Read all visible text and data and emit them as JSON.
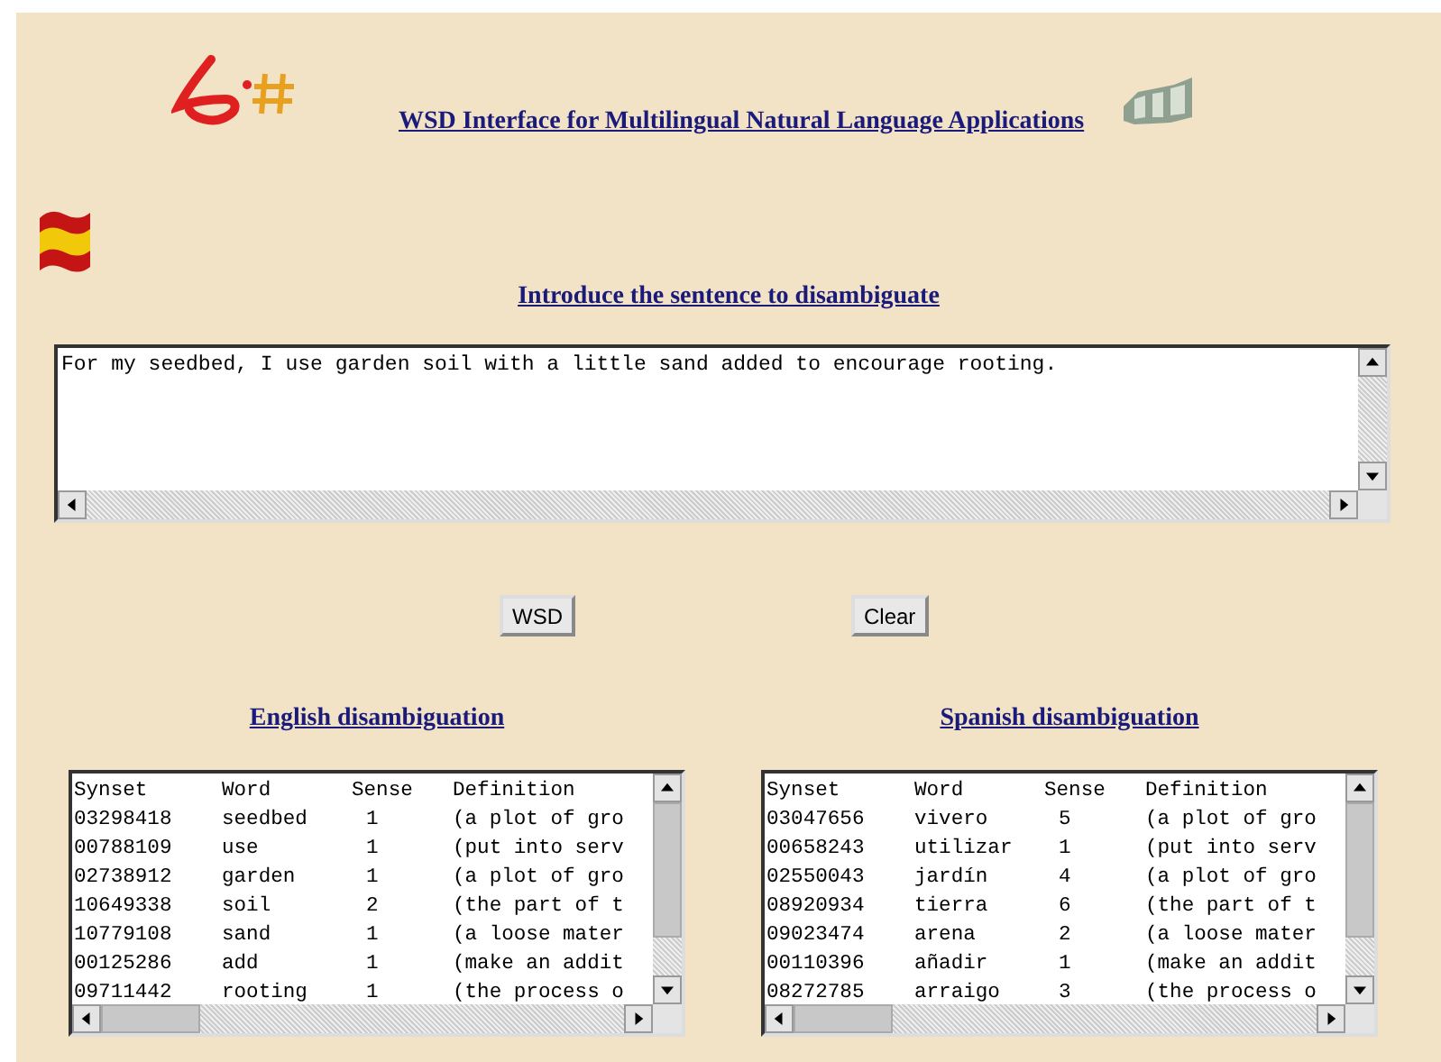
{
  "header": {
    "title": "WSD Interface for Multilingual Natural Language Applications"
  },
  "prompt": "Introduce the sentence to disambiguate",
  "sentence": "For my seedbed, I use garden soil with a little sand added to encourage rooting.",
  "buttons": [
    "WSD",
    "Clear"
  ],
  "results": [
    {
      "heading": "English disambiguation",
      "columns": [
        "Synset",
        "Word",
        "Sense",
        "Definition"
      ],
      "rows": [
        [
          "03298418",
          "seedbed",
          "1",
          "(a plot of gro"
        ],
        [
          "00788109",
          "use",
          "1",
          "(put into serv"
        ],
        [
          "02738912",
          "garden",
          "1",
          "(a plot of gro"
        ],
        [
          "10649338",
          "soil",
          "2",
          "(the part of t"
        ],
        [
          "10779108",
          "sand",
          "1",
          "(a loose mater"
        ],
        [
          "00125286",
          "add",
          "1",
          "(make an addit"
        ],
        [
          "09711442",
          "rooting",
          "1",
          "(the process o"
        ]
      ]
    },
    {
      "heading": "Spanish disambiguation",
      "columns": [
        "Synset",
        "Word",
        "Sense",
        "Definition"
      ],
      "rows": [
        [
          "03047656",
          "vivero",
          "5",
          "(a plot of gro"
        ],
        [
          "00658243",
          "utilizar",
          "1",
          "(put into serv"
        ],
        [
          "02550043",
          "jardín",
          "4",
          "(a plot of gro"
        ],
        [
          "08920934",
          "tierra",
          "6",
          "(the part of t"
        ],
        [
          "09023474",
          "arena",
          "2",
          "(a loose mater"
        ],
        [
          "00110396",
          "añadir",
          "1",
          "(make an addit"
        ],
        [
          "08272785",
          "arraigo",
          "3",
          "(the process o"
        ]
      ]
    }
  ]
}
